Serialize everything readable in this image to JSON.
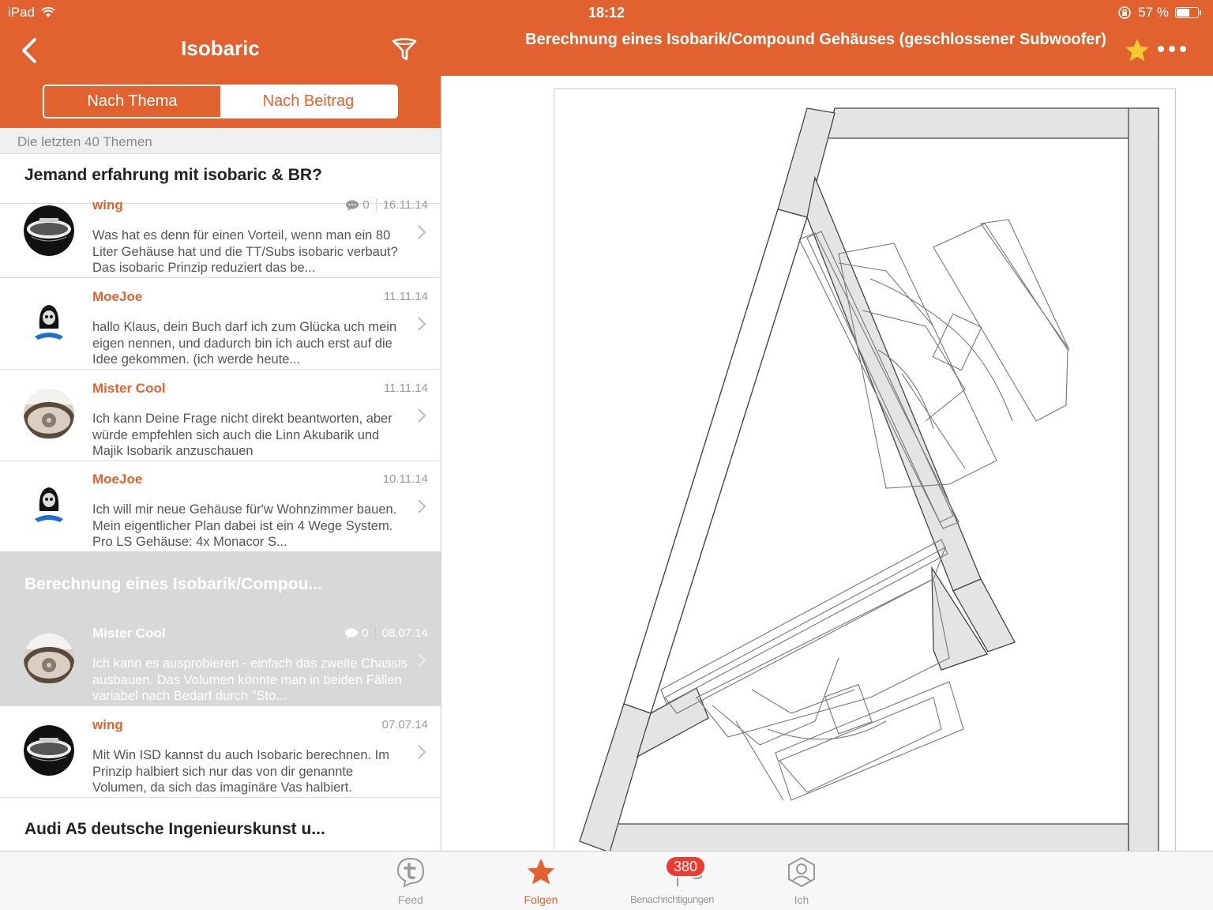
{
  "status_bar": {
    "device": "iPad",
    "time": "18:12",
    "battery": "57 %",
    "battery_level": 0.57
  },
  "left_nav": {
    "title": "Isobaric",
    "segments": [
      "Nach Thema",
      "Nach Beitrag"
    ],
    "selected_segment": 0,
    "section_header": "Die letzten 40 Themen"
  },
  "topics": [
    "Jemand erfahrung mit isobaric & BR?",
    "Berechnung eines Isobarik/Compou...",
    "Audi A5 deutsche Ingenieurskunst u..."
  ],
  "posts": [
    {
      "author": "wing",
      "replies": "0",
      "date": "16.11.14",
      "excerpt": "Was hat es denn für einen Vorteil, wenn man ein 80 Liter Gehäuse hat und die TT/Subs isobaric verbaut? Das isobaric Prinzip reduziert das be...",
      "avatar": "car-logo-avatar"
    },
    {
      "author": "MoeJoe",
      "replies": "",
      "date": "11.11.14",
      "excerpt": "hallo Klaus, dein Buch darf ich zum Glücka uch mein eigen nennen, und dadurch bin ich auch erst auf die Idee gekommen. (ich werde heute...",
      "avatar": "reaper-avatar"
    },
    {
      "author": "Mister Cool",
      "replies": "",
      "date": "11.11.14",
      "excerpt": "Ich kann Deine Frage nicht direkt beantworten, aber würde empfehlen sich auch die Linn Akubarik und Majik Isobarik anzuschauen",
      "avatar": "steering-wheel-avatar"
    },
    {
      "author": "MoeJoe",
      "replies": "",
      "date": "10.11.14",
      "excerpt": "Ich will mir neue Gehäuse für'w Wohnzimmer bauen. Mein eigentlicher Plan dabei ist ein 4 Wege System. Pro LS Gehäuse: 4x Monacor S...",
      "avatar": "reaper-avatar"
    },
    {
      "author": "Mister Cool",
      "replies": "0",
      "date": "08.07.14",
      "excerpt": "Ich kann es ausprobieren - einfach das zweite Chassis ausbauen. Das Volumen könnte man in beiden Fällen variabel nach Bedarf durch \"Sto...",
      "avatar": "steering-wheel-avatar"
    },
    {
      "author": "wing",
      "replies": "",
      "date": "07.07.14",
      "excerpt": "Mit Win ISD kannst du auch Isobaric berechnen. Im Prinzip halbiert sich nur das von dir genannte Volumen, da sich das imaginäre Vas halbiert.",
      "avatar": "car-logo-avatar"
    }
  ],
  "detail": {
    "title": "Berechnung eines Isobarik/Compound Gehäuses (geschlossener Subwoofer)"
  },
  "tabbar": {
    "tabs": [
      {
        "label": "Feed",
        "icon": "tapatalk-icon"
      },
      {
        "label": "Folgen",
        "icon": "star-icon"
      },
      {
        "label": "Benachrichtigungen",
        "icon": "flag-heart-icon",
        "badge": "380"
      },
      {
        "label": "Ich",
        "icon": "person-icon"
      }
    ],
    "active": 1
  },
  "colors": {
    "accent": "#e2622f",
    "selected_row": "#d8d8d8",
    "badge": "#f03a30"
  }
}
